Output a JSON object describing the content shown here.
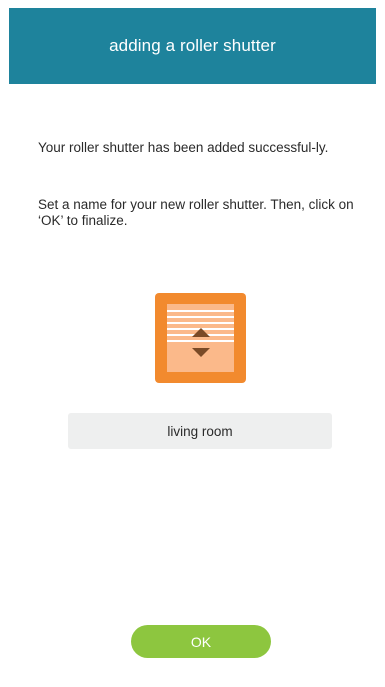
{
  "header": {
    "title": "adding a roller shutter"
  },
  "main": {
    "success_message": "Your roller shutter has been added successful-ly.",
    "instruction": "Set a name for your new roller shutter. Then, click on ‘OK’ to finalize.",
    "device_icon": "roller-shutter-icon",
    "name_field": {
      "value": "living room"
    },
    "ok_label": "OK"
  },
  "colors": {
    "header_bg": "#1e839c",
    "icon_tile": "#f28a2e",
    "ok_button": "#8dc63f",
    "field_bg": "#eeefef"
  }
}
